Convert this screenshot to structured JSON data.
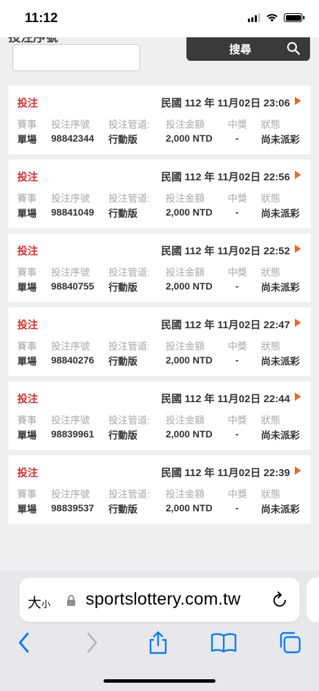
{
  "status_bar": {
    "time": "11:12"
  },
  "search": {
    "label": "投注序號",
    "input_value": "",
    "button_label": "搜尋"
  },
  "columns": [
    "賽事",
    "投注序號",
    "投注管道:",
    "投注金額",
    "中獎",
    "狀態"
  ],
  "bets": [
    {
      "type": "投注",
      "datetime": "民國 112 年 11月02日 23:06",
      "event": "單場",
      "serial": "98842344",
      "channel": "行動版",
      "amount": "2,000 NTD",
      "win": "-",
      "status": "尚未派彩"
    },
    {
      "type": "投注",
      "datetime": "民國 112 年 11月02日 22:56",
      "event": "單場",
      "serial": "98841049",
      "channel": "行動版",
      "amount": "2,000 NTD",
      "win": "-",
      "status": "尚未派彩"
    },
    {
      "type": "投注",
      "datetime": "民國 112 年 11月02日 22:52",
      "event": "單場",
      "serial": "98840755",
      "channel": "行動版",
      "amount": "2,000 NTD",
      "win": "-",
      "status": "尚未派彩"
    },
    {
      "type": "投注",
      "datetime": "民國 112 年 11月02日 22:47",
      "event": "單場",
      "serial": "98840276",
      "channel": "行動版",
      "amount": "2,000 NTD",
      "win": "-",
      "status": "尚未派彩"
    },
    {
      "type": "投注",
      "datetime": "民國 112 年 11月02日 22:44",
      "event": "單場",
      "serial": "98839961",
      "channel": "行動版",
      "amount": "2,000 NTD",
      "win": "-",
      "status": "尚未派彩"
    },
    {
      "type": "投注",
      "datetime": "民國 112 年 11月02日 22:39",
      "event": "單場",
      "serial": "98839537",
      "channel": "行動版",
      "amount": "2,000 NTD",
      "win": "-",
      "status": "尚未派彩"
    }
  ],
  "browser": {
    "aa_large": "大",
    "aa_small": "小",
    "url": "sportslottery.com.tw"
  },
  "icons": {
    "search": "search-icon",
    "arrow": "play-arrow-icon",
    "lock": "lock-icon",
    "reload": "reload-icon",
    "back": "back-icon",
    "forward": "forward-icon",
    "share": "share-icon",
    "bookmarks": "book-icon",
    "tabs": "tabs-icon"
  },
  "colors": {
    "accent_red": "#d32f2f",
    "arrow_orange": "#f26522",
    "safari_blue": "#007aff"
  }
}
